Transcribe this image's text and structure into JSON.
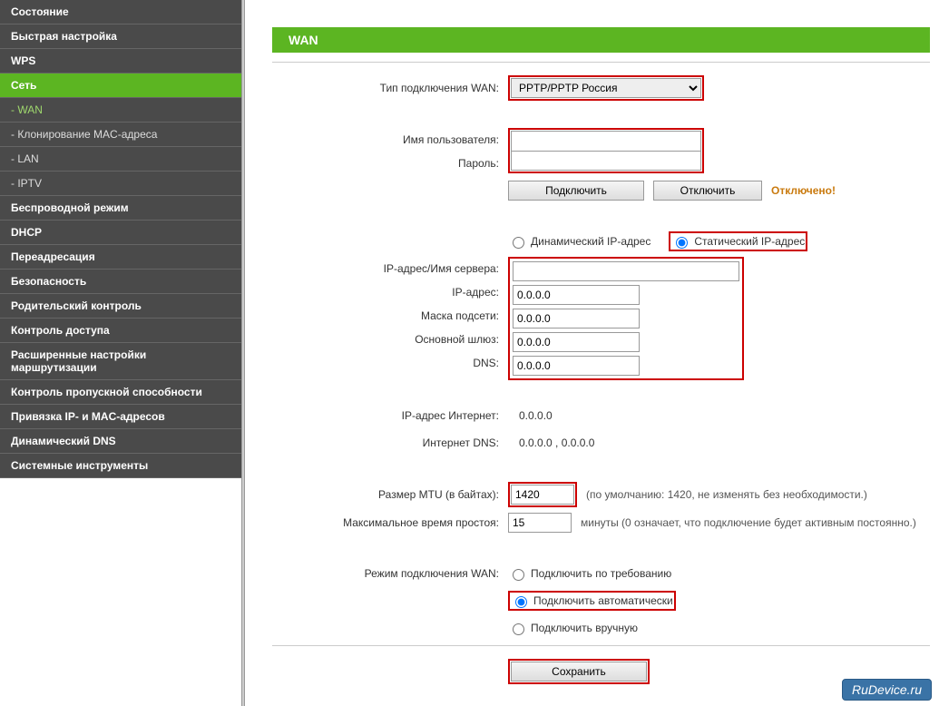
{
  "sidebar": {
    "items": [
      {
        "label": "Состояние",
        "type": "top"
      },
      {
        "label": "Быстрая настройка",
        "type": "top"
      },
      {
        "label": "WPS",
        "type": "top"
      },
      {
        "label": "Сеть",
        "type": "top-active"
      },
      {
        "label": "- WAN",
        "type": "sub-active"
      },
      {
        "label": "- Клонирование MAC-адреса",
        "type": "sub"
      },
      {
        "label": "- LAN",
        "type": "sub"
      },
      {
        "label": "- IPTV",
        "type": "sub"
      },
      {
        "label": "Беспроводной режим",
        "type": "top"
      },
      {
        "label": "DHCP",
        "type": "top"
      },
      {
        "label": "Переадресация",
        "type": "top"
      },
      {
        "label": "Безопасность",
        "type": "top"
      },
      {
        "label": "Родительский контроль",
        "type": "top"
      },
      {
        "label": "Контроль доступа",
        "type": "top"
      },
      {
        "label": "Расширенные настройки маршрутизации",
        "type": "top"
      },
      {
        "label": "Контроль пропускной способности",
        "type": "top"
      },
      {
        "label": "Привязка IP- и MAC-адресов",
        "type": "top"
      },
      {
        "label": "Динамический DNS",
        "type": "top"
      },
      {
        "label": "Системные инструменты",
        "type": "top"
      }
    ]
  },
  "page": {
    "title": "WAN"
  },
  "labels": {
    "conn_type": "Тип подключения WAN:",
    "username": "Имя пользователя:",
    "password": "Пароль:",
    "ip_server": "IP-адрес/Имя сервера:",
    "ip_addr": "IP-адрес:",
    "subnet": "Маска подсети:",
    "gateway": "Основной шлюз:",
    "dns": "DNS:",
    "inet_ip": "IP-адрес Интернет:",
    "inet_dns": "Интернет DNS:",
    "mtu": "Размер MTU (в байтах):",
    "idle": "Максимальное время простоя:",
    "wan_mode": "Режим подключения WAN:"
  },
  "values": {
    "conn_type": "PPTP/PPTP Россия",
    "username": "",
    "password": "",
    "ip_server": "",
    "ip_addr": "0.0.0.0",
    "subnet": "0.0.0.0",
    "gateway": "0.0.0.0",
    "dns": "0.0.0.0",
    "inet_ip": "0.0.0.0",
    "inet_dns": "0.0.0.0 , 0.0.0.0",
    "mtu": "1420",
    "idle": "15"
  },
  "buttons": {
    "connect": "Подключить",
    "disconnect": "Отключить",
    "save": "Сохранить"
  },
  "status": {
    "connection": "Отключено!"
  },
  "radios": {
    "ip_dynamic": "Динамический IP-адрес",
    "ip_static": "Статический IP-адрес",
    "mode_on_demand": "Подключить по требованию",
    "mode_auto": "Подключить автоматически",
    "mode_manual": "Подключить вручную"
  },
  "notes": {
    "mtu": "(по умолчанию: 1420, не изменять без необходимости.)",
    "idle": "минуты (0 означает, что подключение будет активным постоянно.)"
  },
  "watermark": "RuDevice.ru"
}
